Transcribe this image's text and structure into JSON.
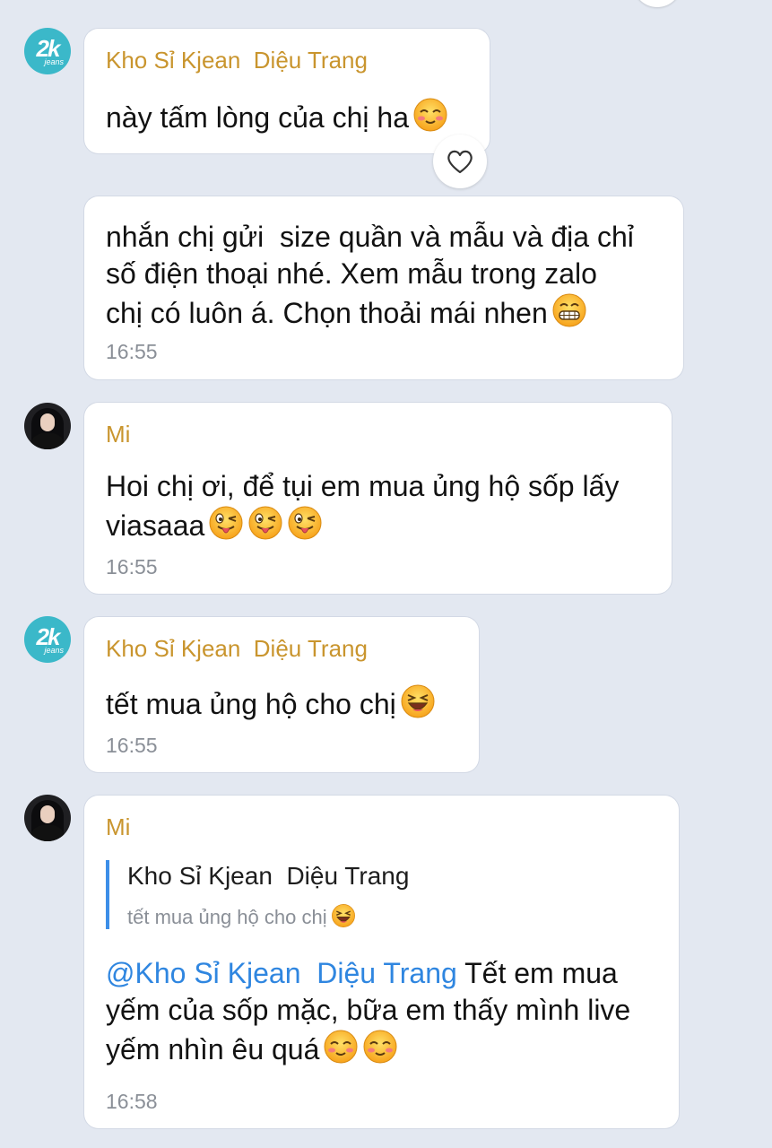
{
  "messages": [
    {
      "sender": "Kho Sỉ Kjean  Diệu Trang",
      "text": "này tấm lòng của chị ha",
      "emoji": "smiling-blush-emoji",
      "reaction": "heart-icon"
    },
    {
      "lines": [
        "nhắn chị gửi  size quần và mẫu và địa chỉ",
        "số điện thoại nhé. Xem mẫu trong zalo",
        "chị có luôn á. Chọn thoải mái nhen"
      ],
      "emoji": "grinning-emoji",
      "time": "16:55"
    },
    {
      "sender": "Mi",
      "lines": [
        "Hoi chị ơi, để tụi em mua ủng hộ sốp lấy",
        "viasaaa"
      ],
      "emoji": "winking-tongue-emoji",
      "time": "16:55"
    },
    {
      "sender": "Kho Sỉ Kjean  Diệu Trang",
      "text": "tết mua ủng hộ cho chị",
      "emoji": "laughing-emoji",
      "time": "16:55"
    },
    {
      "sender": "Mi",
      "quote": {
        "name": "Kho Sỉ Kjean  Diệu Trang",
        "text": "tết mua ủng hộ cho chị"
      },
      "mention": "@Kho Sỉ Kjean  Diệu Trang",
      "line1_rest": " Tết em mua",
      "lines": [
        "yếm của sốp mặc, bữa em thấy mình live",
        "yếm nhìn êu quá"
      ],
      "emoji": "smiling-blush-emoji",
      "time": "16:58"
    }
  ],
  "avatars": {
    "brand_logo": "2k",
    "brand_logo_sub": "jeans"
  },
  "colors": {
    "background": "#e3e8f1",
    "sender_name": "#c9952e",
    "mention": "#2f86e0",
    "quote_bar": "#3c8ee8"
  }
}
